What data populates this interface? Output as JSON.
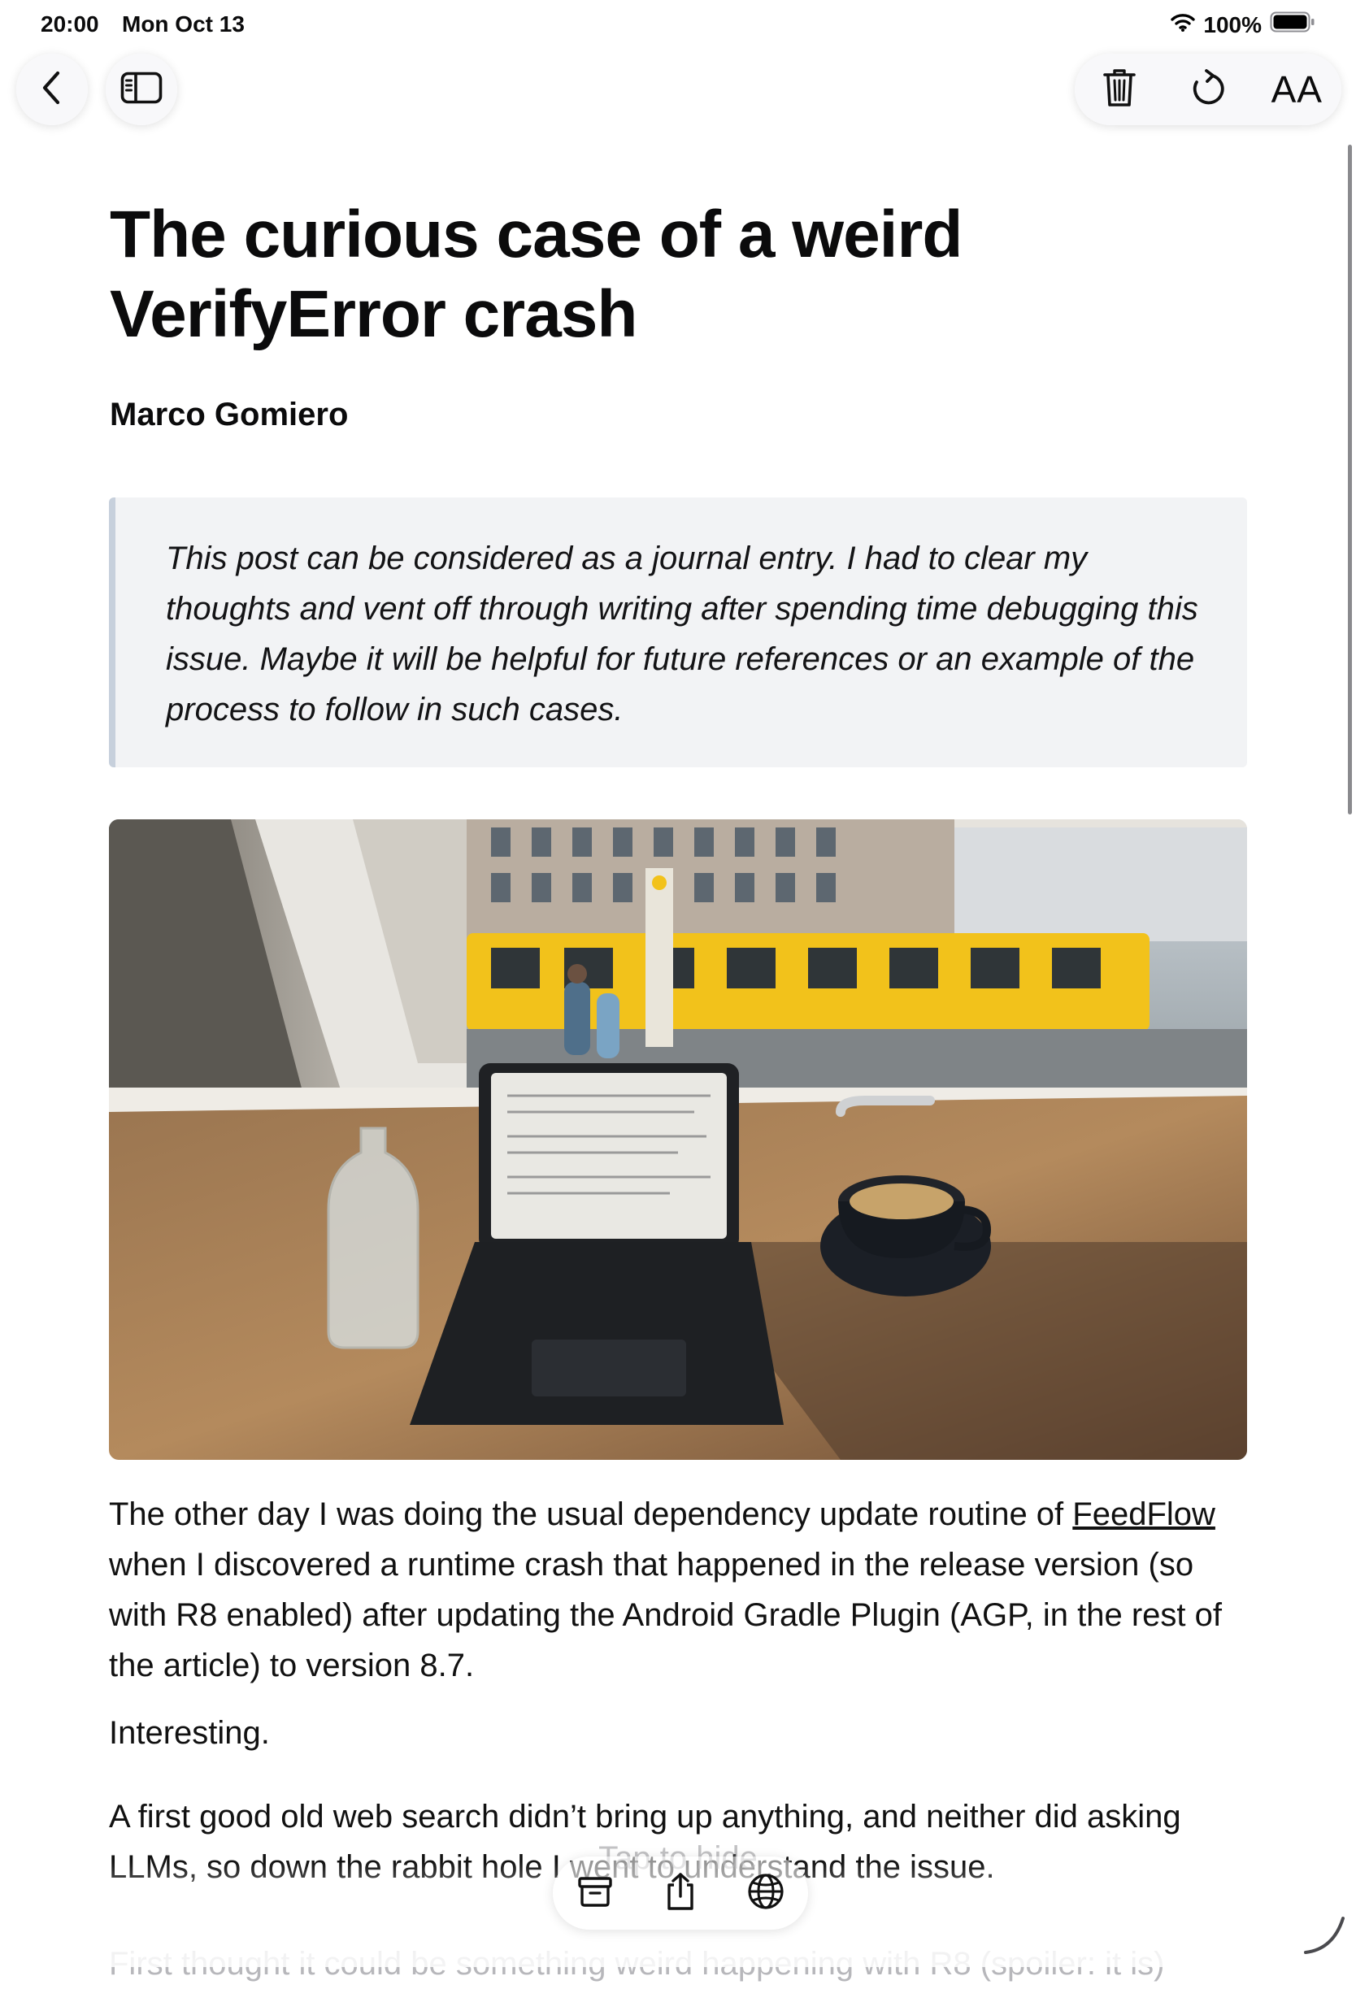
{
  "status_bar": {
    "time": "20:00",
    "date": "Mon Oct 13",
    "battery": "100%",
    "icons": [
      "wifi-icon",
      "battery-icon"
    ]
  },
  "toolbar": {
    "icons": [
      "chevron-left-icon",
      "sidebar-icon",
      "trash-icon",
      "refresh-icon"
    ],
    "text_size_label": "AA"
  },
  "article": {
    "title": "The curious case of a weird VerifyError crash",
    "author": "Marco Gomiero",
    "quote": "This post can be considered as a journal entry. I had to clear my thoughts and vent off through writing after spending time debugging this issue. Maybe it will be helpful for future references or an example of the process to follow in such cases.",
    "image_icon": "photo-laptop-cafe-window",
    "p1_before": "The other day I was doing the usual dependency update routine of ",
    "p1_link": "FeedFlow",
    "p1_after": " when I discovered a runtime crash that happened in the release version (so with R8 enabled) after updating the Android Gradle Plugin (AGP, in the rest of the article) to version 8.7.",
    "p2": "Interesting.",
    "p3": "A first good old web search didn’t bring up anything, and neither did asking LLMs, so down the rabbit hole I went to understand the issue.",
    "p4": "First thought it could be something weird happening with R8 (spoiler: it is)"
  },
  "overlay_hint": "Tap to hide",
  "bottom_bar": {
    "icons": [
      "archive-icon",
      "share-icon",
      "globe-icon"
    ]
  },
  "colors": {
    "background": "#ffffff",
    "quote_background": "#f2f3f5",
    "quote_border": "#c7d0dc",
    "text": "#0b0b0c",
    "muted_text": "#b7b7bb"
  }
}
